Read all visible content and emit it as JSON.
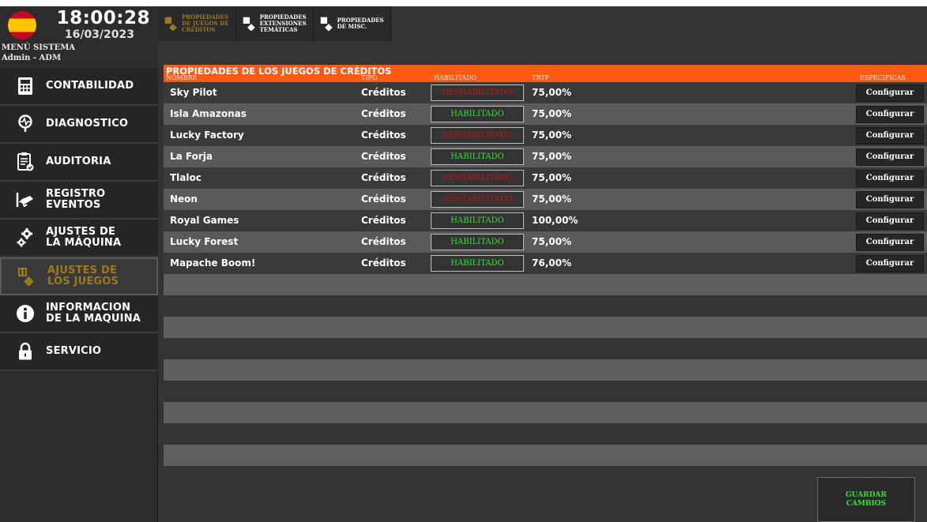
{
  "header": {
    "time": "18:00:28",
    "date": "16/03/2023",
    "system_menu": "MENÚ SISTEMA",
    "user": "Admin - ADM"
  },
  "sidebar": {
    "items": [
      {
        "label": "CONTABILIDAD",
        "icon": "calculator-icon"
      },
      {
        "label": "DIAGNOSTICO",
        "icon": "stethoscope-icon"
      },
      {
        "label": "AUDITORIA",
        "icon": "clipboard-check-icon"
      },
      {
        "label": "REGISTRO\nEVENTOS",
        "icon": "camera-icon"
      },
      {
        "label": "AJUSTES DE\nLA MÁQUINA",
        "icon": "gears-icon"
      },
      {
        "label": "AJUSTES DE\nLOS JUEGOS",
        "icon": "games-icon",
        "active": true
      },
      {
        "label": "INFORMACION\nDE LA MAQUINA",
        "icon": "info-icon"
      },
      {
        "label": "SERVICIO",
        "icon": "lock-icon"
      }
    ]
  },
  "tabs": [
    {
      "label": "PROPIEDADES\nDE JUEGOS DE\nCRÉDITOS",
      "active": true
    },
    {
      "label": "PROPIEDADES\nEXTENSIONES\nTEMÁTICAS",
      "active": false
    },
    {
      "label": "PROPIEDADES\nDE MISC.",
      "active": false
    }
  ],
  "panel": {
    "title": "PROPIEDADES DE LOS JUEGOS DE CRÉDITOS",
    "columns": {
      "name": "NOMBRE",
      "type": "TIPO",
      "enabled": "HABILITADO",
      "rtp": "TRTP",
      "specific": "ESPECÍFICAS"
    }
  },
  "games": [
    {
      "name": "Sky Pilot",
      "type": "Créditos",
      "status": "DESHABILITADO",
      "enabled": false,
      "rtp": "75,00%",
      "action": "Configurar"
    },
    {
      "name": "Isla Amazonas",
      "type": "Créditos",
      "status": "HABILITADO",
      "enabled": true,
      "rtp": "75,00%",
      "action": "Configurar"
    },
    {
      "name": "Lucky Factory",
      "type": "Créditos",
      "status": "DESHABILITADO",
      "enabled": false,
      "rtp": "75,00%",
      "action": "Configurar"
    },
    {
      "name": "La Forja",
      "type": "Créditos",
      "status": "HABILITADO",
      "enabled": true,
      "rtp": "75,00%",
      "action": "Configurar"
    },
    {
      "name": "Tlaloc",
      "type": "Créditos",
      "status": "DESHABILITADO",
      "enabled": false,
      "rtp": "75,00%",
      "action": "Configurar"
    },
    {
      "name": "Neon",
      "type": "Créditos",
      "status": "DESHABILITADO",
      "enabled": false,
      "rtp": "75,00%",
      "action": "Configurar"
    },
    {
      "name": "Royal Games",
      "type": "Créditos",
      "status": "HABILITADO",
      "enabled": true,
      "rtp": "100,00%",
      "action": "Configurar"
    },
    {
      "name": "Lucky Forest",
      "type": "Créditos",
      "status": "HABILITADO",
      "enabled": true,
      "rtp": "75,00%",
      "action": "Configurar"
    },
    {
      "name": "Mapache Boom!",
      "type": "Créditos",
      "status": "HABILITADO",
      "enabled": true,
      "rtp": "76,00%",
      "action": "Configurar"
    }
  ],
  "save_button": "GUARDAR\nCAMBIOS",
  "colors": {
    "accent": "#ff5a14",
    "enabled": "#2fe22f",
    "disabled": "#c0141a",
    "active_menu": "#9c7a1c"
  }
}
